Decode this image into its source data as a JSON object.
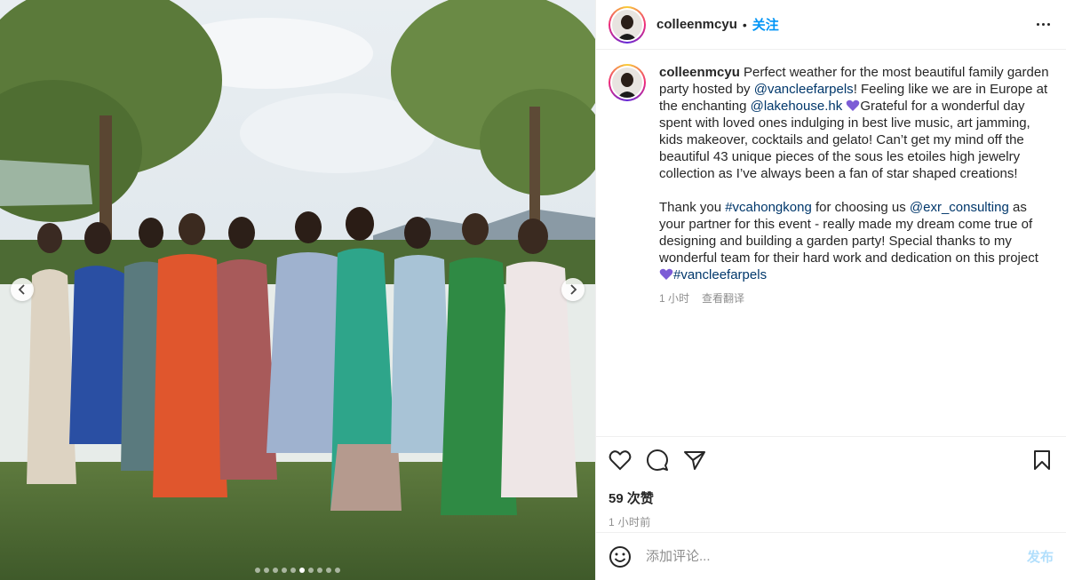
{
  "post": {
    "username": "colleenmcyu",
    "separator": "•",
    "follow_label": "关注",
    "more_icon": "more-horizontal-icon"
  },
  "caption": {
    "username": "colleenmcyu",
    "t1": " Perfect weather for the most beautiful family garden party hosted by ",
    "m1": "@vancleefarpels",
    "t2": "! Feeling like we are in Europe at the enchanting ",
    "m2": "@lakehouse.hk",
    "t3": "Grateful for a wonderful day spent with loved ones indulging in best live music, art jamming, kids makeover, cocktails and gelato! Can’t get my mind off the beautiful 43 unique pieces of the sous les etoiles high jewelry collection as I’ve always been a fan of star shaped creations!",
    "t4": "Thank you ",
    "m3": "#vcahongkong",
    "t5": " for choosing us ",
    "m4": "@exr_consulting",
    "t6": " as your partner for this event - really made my dream come true of designing and building a garden party! Special thanks to my wonderful team for their hard work and dedication on this project ",
    "m5": "#vancleefarpels",
    "age": "1 小时",
    "translate_label": "查看翻译",
    "heart_color": "#7c5cd6"
  },
  "actions": {
    "likes": "59 次赞",
    "time": "1 小时前"
  },
  "comment": {
    "placeholder": "添加评论...",
    "post_label": "发布"
  },
  "carousel": {
    "slide_count": 10,
    "active_index": 5
  },
  "colors": {
    "accent": "#0095f6",
    "link": "#00376b",
    "muted": "#8e8e8e"
  }
}
